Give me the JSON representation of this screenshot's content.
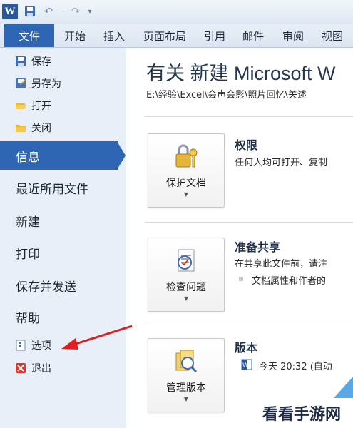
{
  "window": {
    "app_icon": "W",
    "quick_access": {
      "save": "save-icon",
      "undo": "↶",
      "separator": "·",
      "redo": "↷",
      "dropdown": "▾"
    }
  },
  "ribbon": {
    "file_tab": "文件",
    "tabs": [
      "开始",
      "插入",
      "页面布局",
      "引用",
      "邮件",
      "审阅",
      "视图"
    ]
  },
  "nav": {
    "save": "保存",
    "save_as": "另存为",
    "open": "打开",
    "close": "关闭",
    "info": "信息",
    "recent": "最近所用文件",
    "new": "新建",
    "print": "打印",
    "save_send": "保存并发送",
    "help": "帮助",
    "options": "选项",
    "exit": "退出"
  },
  "main": {
    "heading": "有关 新建 Microsoft W",
    "path": "E:\\经验\\Excel\\会声会影\\照片回忆\\关述",
    "sections": [
      {
        "button": "保护文档",
        "title": "权限",
        "desc": "任何人均可打开、复制"
      },
      {
        "button": "检查问题",
        "title": "准备共享",
        "desc": "在共享此文件前，请注",
        "bullet": "文档属性和作者的"
      },
      {
        "button": "管理版本",
        "title": "版本",
        "desc": "今天 20:32 (自动"
      }
    ]
  },
  "watermark": "看看手游网",
  "colors": {
    "accent": "#2f66b3",
    "arrow": "#e01e1e",
    "nav_bg": "#e9eff8"
  }
}
